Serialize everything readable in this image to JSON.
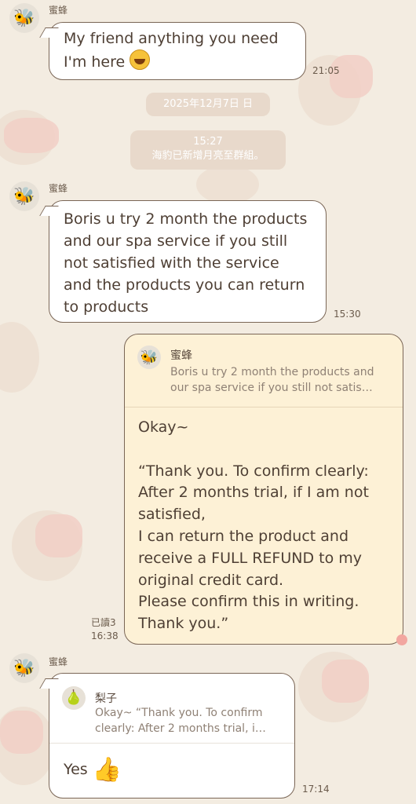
{
  "messages": [
    {
      "sender": "蜜蜂",
      "text_line1": "My friend anything you need",
      "text_line2": "I'm here",
      "time": "21:05"
    },
    {
      "sender": "蜜蜂",
      "text": "Boris u try 2 month the products and our spa service if you still not satisfied with the service and the products you can return to products",
      "time": "15:30"
    }
  ],
  "date_separator": "2025年12月7日 日",
  "system_notice": {
    "time": "15:27",
    "text": "海豹已新增月亮至群組。"
  },
  "my_reply": {
    "quote_sender": "蜜蜂",
    "quote_line1": "Boris u try 2 month the products and",
    "quote_line2": "our spa service if you still not satis…",
    "lines": [
      "Okay~",
      "",
      "“Thank you. To confirm clearly:",
      "After 2 months trial, if I am not",
      "satisfied,",
      "I can return the product and",
      "receive a FULL REFUND to my",
      "original credit card.",
      "Please confirm this in writing.",
      "Thank you.”"
    ],
    "read_status": "已讀3",
    "time": "16:38"
  },
  "last_message": {
    "sender": "蜜蜂",
    "quote_sender": "梨子",
    "quote_line1": "Okay~ “Thank you. To confirm",
    "quote_line2": "clearly: After 2 months trial, i…",
    "text": "Yes",
    "emoji": "👍",
    "time": "17:14"
  },
  "icons": {
    "bee_avatar": "🐝",
    "pear_avatar": "🍐"
  },
  "colors": {
    "background": "#f3ece1",
    "my_bubble": "#fdf1d6",
    "other_bubble": "#ffffff",
    "bubble_border": "#7a6656"
  }
}
